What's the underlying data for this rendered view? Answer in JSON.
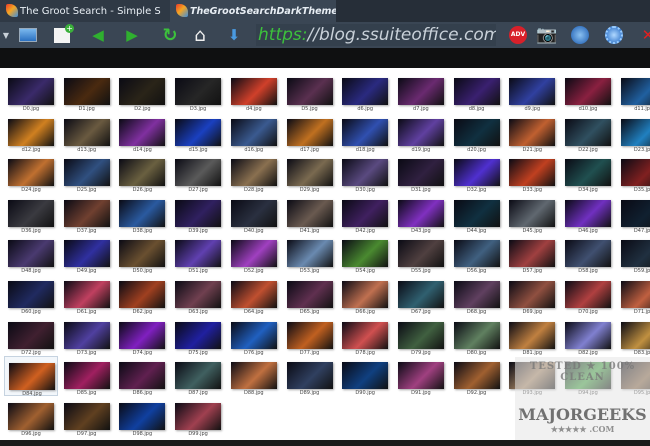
{
  "tabs": [
    {
      "label": "The Groot Search - Simple S",
      "active": false
    },
    {
      "label": "TheGrootSearchDarkThemeWall",
      "active": true
    }
  ],
  "toolbar": {
    "icons": [
      "dropdown-arrow-icon",
      "monitor-icon",
      "new-tab-icon",
      "back-icon",
      "forward-icon",
      "refresh-icon",
      "home-icon",
      "download-icon",
      "adblock-icon",
      "camera-icon",
      "tools-icon",
      "settings-gear-icon",
      "close-icon"
    ],
    "adv_label": "ADV",
    "url_scheme": "https:",
    "url_rest": "//blog.ssuiteoffice.com"
  },
  "watermark": {
    "line1": "TESTED ★ 100% CLEAN",
    "line2": "MAJORGEEKS",
    "line3": "★★★★★ .COM"
  },
  "gallery": {
    "selected": "D84.jpg",
    "files": [
      "D0.jpg",
      "D1.jpg",
      "D2.jpg",
      "D3.jpg",
      "d4.jpg",
      "D5.jpg",
      "d6.jpg",
      "d7.jpg",
      "d8.jpg",
      "d9.jpg",
      "d10.jpg",
      "d11.jpg",
      "d12.jpg",
      "d13.jpg",
      "d14.jpg",
      "d15.jpg",
      "d16.jpg",
      "d17.jpg",
      "d18.jpg",
      "d19.jpg",
      "d20.jpg",
      "D21.jpg",
      "D22.jpg",
      "D23.jpg",
      "D24.jpg",
      "D25.jpg",
      "D26.jpg",
      "D27.jpg",
      "D28.jpg",
      "D29.jpg",
      "D30.jpg",
      "D31.jpg",
      "D32.jpg",
      "D33.jpg",
      "D34.jpg",
      "D35.jpg",
      "D36.jpg",
      "D37.jpg",
      "D38.jpg",
      "D39.jpg",
      "D40.jpg",
      "D41.jpg",
      "D42.jpg",
      "D43.jpg",
      "D44.jpg",
      "D45.jpg",
      "D46.jpg",
      "D47.jpg",
      "D48.jpg",
      "D49.jpg",
      "D50.jpg",
      "D51.jpg",
      "D52.jpg",
      "D53.jpg",
      "D54.jpg",
      "D55.jpg",
      "D56.jpg",
      "D57.jpg",
      "D58.jpg",
      "D59.jpg",
      "D60.jpg",
      "D61.jpg",
      "D62.jpg",
      "D63.jpg",
      "D64.jpg",
      "D65.jpg",
      "D66.jpg",
      "D67.jpg",
      "D68.jpg",
      "D69.jpg",
      "D70.jpg",
      "D71.jpg",
      "D72.jpg",
      "D73.jpg",
      "D74.jpg",
      "D75.jpg",
      "D76.jpg",
      "D77.jpg",
      "D78.jpg",
      "D79.jpg",
      "D80.jpg",
      "D81.jpg",
      "D82.jpg",
      "D83.jpg",
      "D84.jpg",
      "D85.jpg",
      "D86.jpg",
      "D87.jpg",
      "D88.jpg",
      "D89.jpg",
      "D90.jpg",
      "D91.jpg",
      "D92.jpg",
      "D93.jpg",
      "D94.jpg",
      "D95.jpg",
      "D96.jpg",
      "D97.jpg",
      "D98.jpg",
      "D99.jpg"
    ],
    "thumb_colors": [
      "#3a2a6a",
      "#4a2a10",
      "#2a2418",
      "#262626",
      "#d0402a",
      "#5a3050",
      "#2a2a80",
      "#6a2a70",
      "#3a2070",
      "#3040a0",
      "#8a2040",
      "#2060a0",
      "#d08020",
      "#6a5a40",
      "#8030a0",
      "#1a40c0",
      "#3a5a90",
      "#c07020",
      "#3050b0",
      "#6040a0",
      "#103040",
      "#c06030",
      "#305060",
      "#2080c0",
      "#c07030",
      "#305080",
      "#6a6040",
      "#5a5a5a",
      "#8a7050",
      "#7a6a50",
      "#5a4a80",
      "#302040",
      "#5030d0",
      "#c04020",
      "#205050",
      "#802020",
      "#3a3a40",
      "#704030",
      "#2a5aa0",
      "#302060",
      "#2a3040",
      "#6a5a50",
      "#402060",
      "#8030c0",
      "#103040",
      "#606870",
      "#7030c0",
      "#102030",
      "#4a3a70",
      "#3030a0",
      "#6a5030",
      "#6040b0",
      "#a040c0",
      "#6a8ab0",
      "#4a8a30",
      "#504040",
      "#406080",
      "#a04040",
      "#405070",
      "#203040",
      "#202a60",
      "#c04060",
      "#a04020",
      "#704050",
      "#c05030",
      "#603050",
      "#c07050",
      "#306070",
      "#604060",
      "#905040",
      "#b04040",
      "#c06040",
      "#402030",
      "#5040a0",
      "#8020c0",
      "#2020a0",
      "#2060c0",
      "#c06020",
      "#d05050",
      "#406040",
      "#608060",
      "#c08040",
      "#8080d0",
      "#c09040",
      "#d06020",
      "#a02060",
      "#602050",
      "#406060",
      "#c07040",
      "#304060",
      "#104080",
      "#a04080",
      "#a06030",
      "#a08060",
      "#40a040",
      "#806040",
      "#a06030",
      "#604020",
      "#1040a0",
      "#a04050"
    ]
  }
}
